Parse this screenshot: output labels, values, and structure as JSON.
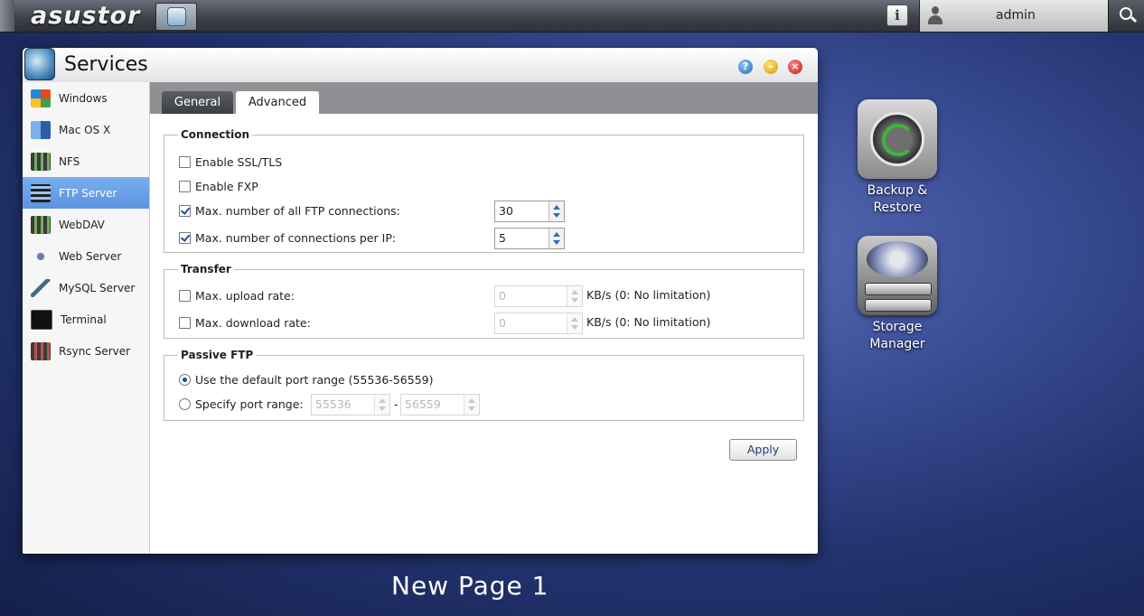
{
  "topbar": {
    "logo": "asustor",
    "user_name": "admin"
  },
  "window": {
    "title": "Services",
    "sidebar": [
      {
        "label": "Windows",
        "icon": "windows-icon",
        "active": false
      },
      {
        "label": "Mac OS X",
        "icon": "finder-icon",
        "active": false
      },
      {
        "label": "NFS",
        "icon": "nfs-icon",
        "active": false
      },
      {
        "label": "FTP Server",
        "icon": "ftp-icon",
        "active": true
      },
      {
        "label": "WebDAV",
        "icon": "webdav-icon",
        "active": false
      },
      {
        "label": "Web Server",
        "icon": "web-server-icon",
        "active": false
      },
      {
        "label": "MySQL Server",
        "icon": "mysql-icon",
        "active": false
      },
      {
        "label": "Terminal",
        "icon": "terminal-icon",
        "active": false
      },
      {
        "label": "Rsync Server",
        "icon": "rsync-icon",
        "active": false
      }
    ],
    "tabs": {
      "general": "General",
      "advanced": "Advanced",
      "active": "Advanced"
    },
    "connection": {
      "legend": "Connection",
      "enable_ssl": {
        "label": "Enable SSL/TLS",
        "checked": false
      },
      "enable_fxp": {
        "label": "Enable FXP",
        "checked": false
      },
      "max_all": {
        "label": "Max. number of all FTP connections:",
        "checked": true,
        "value": "30"
      },
      "max_per_ip": {
        "label": "Max. number of connections per IP:",
        "checked": true,
        "value": "5"
      }
    },
    "transfer": {
      "legend": "Transfer",
      "upload": {
        "label": "Max. upload rate:",
        "checked": false,
        "value": "0",
        "unit": "KB/s (0: No limitation)"
      },
      "download": {
        "label": "Max. download rate:",
        "checked": false,
        "value": "0",
        "unit": "KB/s (0: No limitation)"
      }
    },
    "passive": {
      "legend": "Passive FTP",
      "default_range": {
        "label": "Use the default port range (55536-56559)",
        "selected": true
      },
      "specify_range": {
        "label": "Specify port range:",
        "selected": false,
        "from": "55536",
        "separator": "-",
        "to": "56559"
      }
    },
    "apply_label": "Apply"
  },
  "desktop": {
    "icons": [
      {
        "label_line1": "Backup &",
        "label_line2": "Restore"
      },
      {
        "label_line1": "Storage",
        "label_line2": "Manager"
      }
    ],
    "page_label": "New Page 1"
  }
}
